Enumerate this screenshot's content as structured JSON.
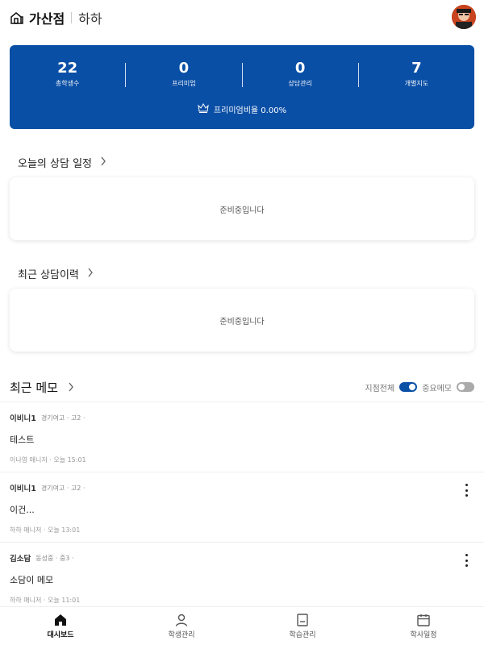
{
  "header": {
    "store_name": "가산점",
    "manager_name": "하하"
  },
  "stats": {
    "items": [
      {
        "value": "22",
        "label": "총학생수"
      },
      {
        "value": "0",
        "label": "프리미엄"
      },
      {
        "value": "0",
        "label": "상담관리"
      },
      {
        "value": "7",
        "label": "개별지도"
      }
    ],
    "premium_ratio": "프리미엄비율 0.00%"
  },
  "today_schedule": {
    "title": "오늘의 상담 일정",
    "placeholder": "준비중입니다"
  },
  "recent_consult": {
    "title": "최근 상담이력",
    "placeholder": "준비중입니다"
  },
  "memos": {
    "title": "최근 메모",
    "toggle_all_label": "지점전체",
    "toggle_important_label": "중요메모",
    "items": [
      {
        "student": "이비니1",
        "school": "경기여고 · 고2 ·",
        "content": "테스트",
        "footer": "이나영 매니저 · 오늘 15:01",
        "has_menu": false
      },
      {
        "student": "이비니1",
        "school": "경기여고 · 고2 ·",
        "content": "이건...",
        "footer": "하하 매니저 · 오늘 13:01",
        "has_menu": true
      },
      {
        "student": "김소담",
        "school": "동성중 · 중3 ·",
        "content": "소담이 메모",
        "footer": "하하 매니저 · 오늘 11:01",
        "has_menu": true
      }
    ]
  },
  "bottom_nav": {
    "items": [
      {
        "label": "대시보드",
        "icon": "home-icon",
        "active": true
      },
      {
        "label": "학생관리",
        "icon": "person-icon",
        "active": false
      },
      {
        "label": "학습관리",
        "icon": "book-icon",
        "active": false
      },
      {
        "label": "학사일정",
        "icon": "calendar-icon",
        "active": false
      }
    ]
  },
  "colors": {
    "primary": "#0a4fa6"
  }
}
